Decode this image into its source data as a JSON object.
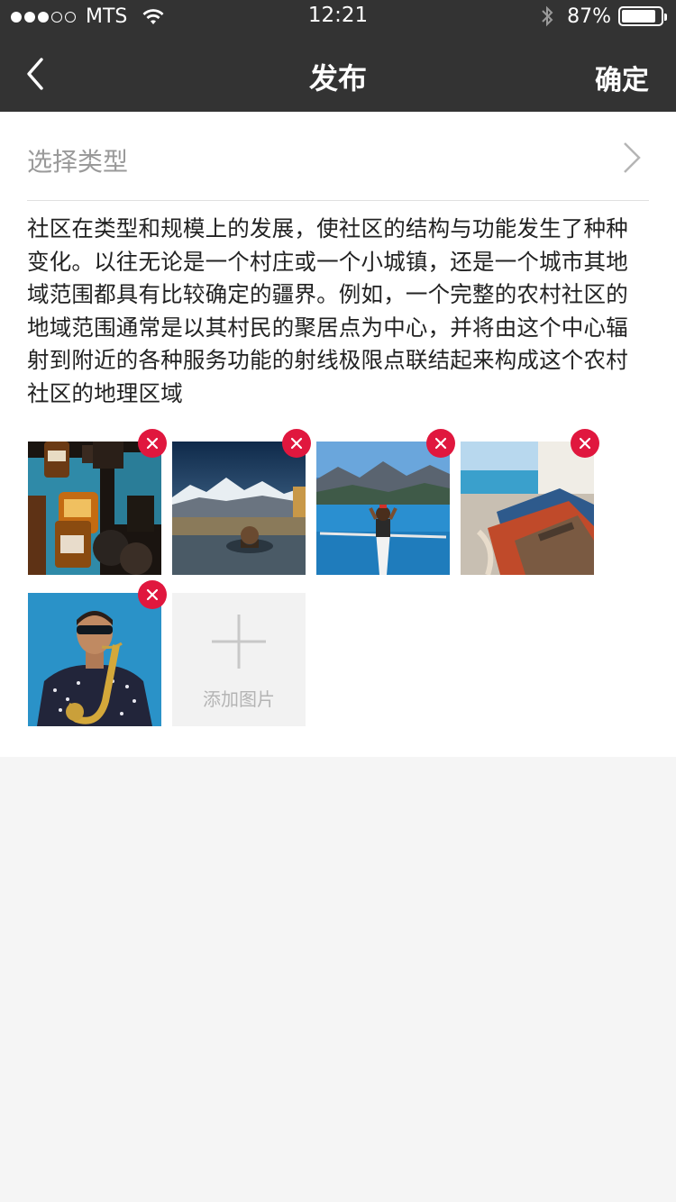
{
  "status_bar": {
    "carrier": "MTS",
    "time": "12:21",
    "battery_percent": "87%",
    "battery_level": 0.87,
    "signal_bars_filled": 3,
    "signal_bars_total": 5
  },
  "navbar": {
    "title": "发布",
    "confirm_label": "确定",
    "back_icon": "chevron-left-icon"
  },
  "type_selector": {
    "label": "选择类型",
    "icon": "chevron-right-icon"
  },
  "description": "社区在类型和规模上的发展，使社区的结构与功能发生了种种变化。以往无论是一个村庄或一个小城镇，还是一个城市其地域范围都具有比较确定的疆界。例如，一个完整的农村社区的地域范围通常是以其村民的聚居点为中心，并将由这个中心辐射到附近的各种服务功能的射线极限点联结起来构成这个农村社区的地理区域",
  "photos": [
    {
      "subject": "apothecary bottles on blue cabinet"
    },
    {
      "subject": "man in hot spring with snowy mountains"
    },
    {
      "subject": "person in kayak on lake"
    },
    {
      "subject": "boat on beach"
    },
    {
      "subject": "saxophone player with sunglasses"
    }
  ],
  "add_photo": {
    "label": "添加图片"
  },
  "colors": {
    "header_bg": "#333333",
    "remove_badge": "#e0173e",
    "page_bg": "#f5f5f5"
  }
}
